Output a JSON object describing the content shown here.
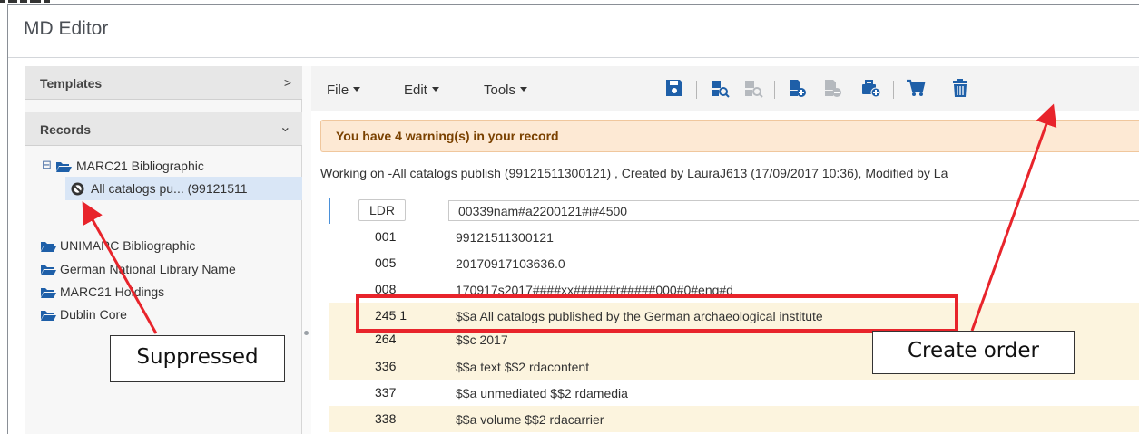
{
  "app": {
    "title": "MD Editor"
  },
  "left_panel": {
    "templates_label": "Templates",
    "templates_chevron": ">",
    "records_label": "Records",
    "records_chevron": "⌄",
    "tree": [
      {
        "label": "MARC21 Bibliographic",
        "icon": "folder-open-icon",
        "expander": "⊟"
      },
      {
        "label": "All catalogs pu... (99121511",
        "icon": "suppressed-icon",
        "selected": true
      },
      {
        "label": "UNIMARC Bibliographic",
        "icon": "folder-open-icon"
      },
      {
        "label": "German National Library Name",
        "icon": "folder-open-icon"
      },
      {
        "label": "MARC21 Holdings",
        "icon": "folder-open-icon"
      },
      {
        "label": "Dublin Core",
        "icon": "folder-open-icon"
      }
    ]
  },
  "toolbar": {
    "menus": [
      "File",
      "Edit",
      "Tools"
    ],
    "icons": [
      "save-icon",
      "search-record-icon",
      "search-record-disabled-icon",
      "add-record-icon",
      "add-record-disabled-icon",
      "add-item-icon",
      "cart-icon",
      "delete-icon"
    ]
  },
  "warning": "You have 4 warning(s) in your record",
  "working_text": "Working on -All catalogs publish (99121511300121) , Created by LauraJ613 (17/09/2017 10:36), Modified by La",
  "fields": [
    {
      "tag": "LDR",
      "value": "00339nam#a2200121#i#4500"
    },
    {
      "tag": "001",
      "value": "99121511300121"
    },
    {
      "tag": "005",
      "value": "20170917103636.0"
    },
    {
      "tag": "008",
      "value": "170917s2017####xx######r#####000#0#eng#d"
    },
    {
      "tag": "245 1",
      "value": "$$a All catalogs published by the German archaeological institute"
    },
    {
      "tag": "264",
      "value": "$$c 2017"
    },
    {
      "tag": "336",
      "value": "$$a text $$2 rdacontent"
    },
    {
      "tag": "337",
      "value": "$$a unmediated $$2 rdamedia"
    },
    {
      "tag": "338",
      "value": "$$a volume $$2 rdacarrier"
    }
  ],
  "annotations": {
    "suppressed": "Suppressed",
    "create_order": "Create order",
    "annotation_color": "#e8242b"
  },
  "colors": {
    "warning_bg": "#fde9d4",
    "field_highlight": "#fcf4de",
    "selection": "#d9e6f6",
    "icon_blue": "#1e5fa8"
  }
}
